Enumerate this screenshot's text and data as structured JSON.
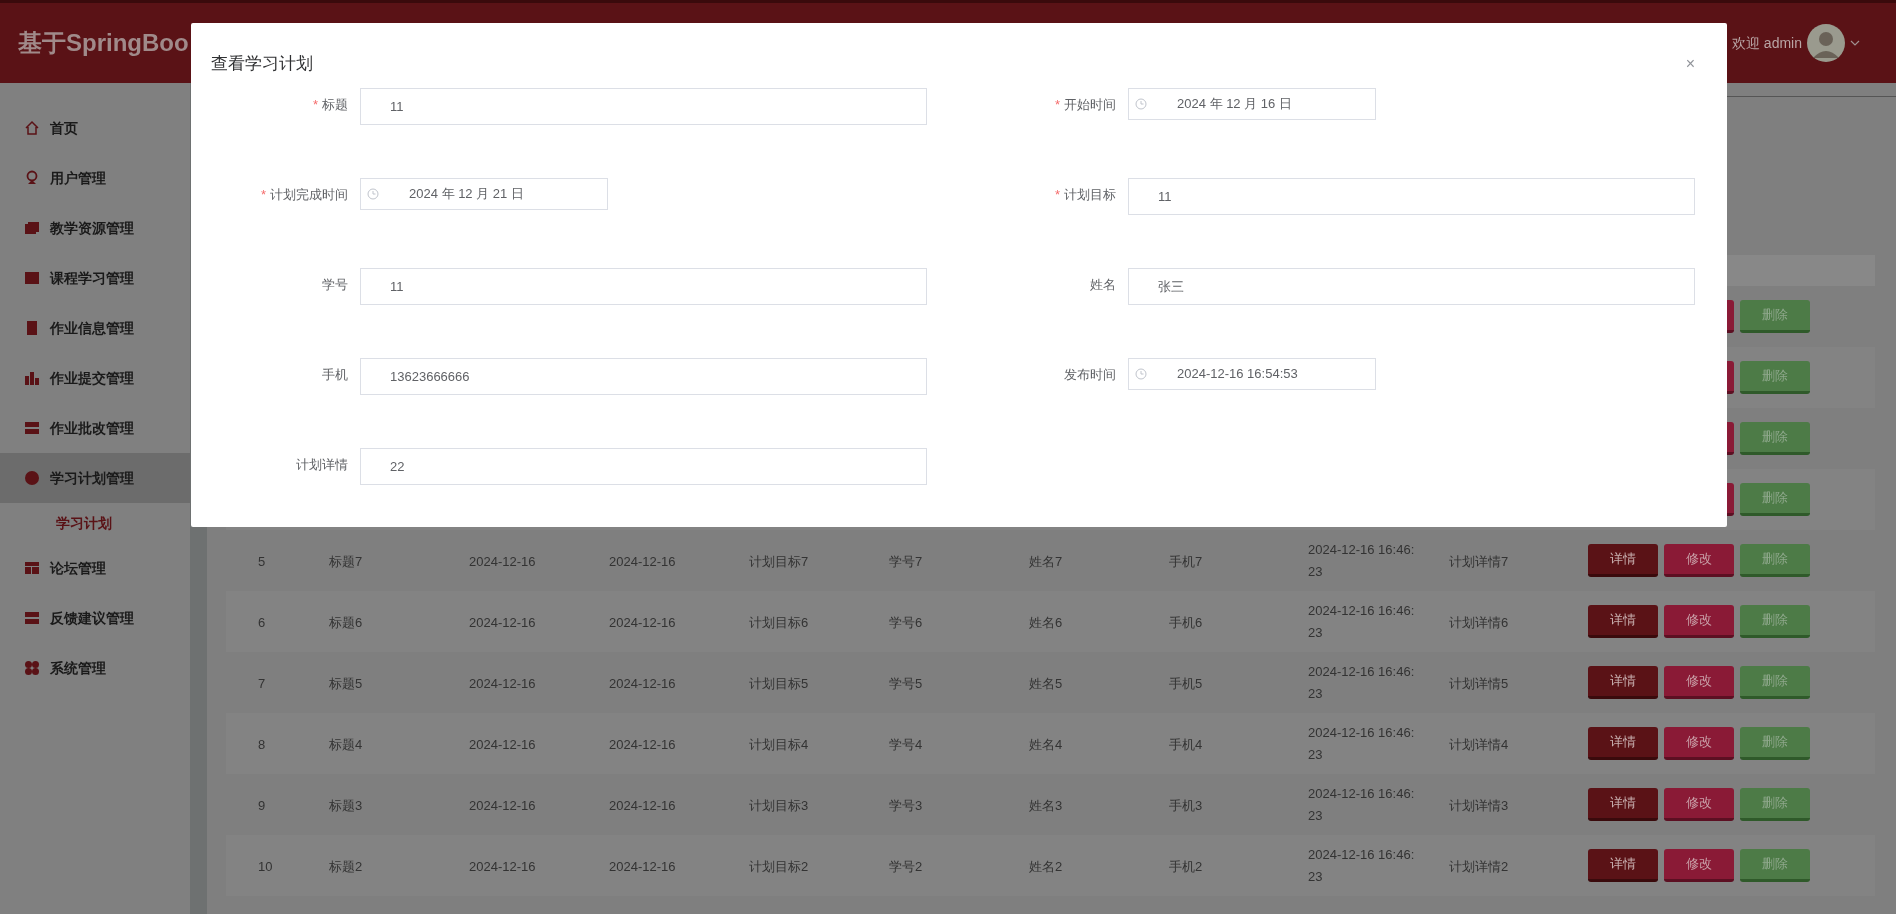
{
  "header": {
    "title": "基于SpringBoo",
    "greeting": "欢迎 admin"
  },
  "sidebar": {
    "items": [
      {
        "label": "首页",
        "selected": false
      },
      {
        "label": "用户管理",
        "selected": false
      },
      {
        "label": "教学资源管理",
        "selected": false
      },
      {
        "label": "课程学习管理",
        "selected": false
      },
      {
        "label": "作业信息管理",
        "selected": false
      },
      {
        "label": "作业提交管理",
        "selected": false
      },
      {
        "label": "作业批改管理",
        "selected": false
      },
      {
        "label": "学习计划管理",
        "selected": true,
        "children": [
          {
            "label": "学习计划",
            "selected": true
          }
        ]
      },
      {
        "label": "论坛管理",
        "selected": false
      },
      {
        "label": "反馈建议管理",
        "selected": false
      },
      {
        "label": "系统管理",
        "selected": false
      }
    ]
  },
  "table": {
    "rows": [
      {
        "actions": [
          {
            "label": "删除",
            "kind": "delete"
          }
        ]
      },
      {
        "actions": [
          {
            "label": "删除",
            "kind": "delete"
          }
        ]
      },
      {
        "actions": [
          {
            "label": "删除",
            "kind": "delete"
          }
        ]
      },
      {
        "actions": [
          {
            "label": "删除",
            "kind": "delete"
          }
        ]
      },
      {
        "cells": [
          "5",
          "标题7",
          "2024-12-16",
          "2024-12-16",
          "计划目标7",
          "学号7",
          "姓名7",
          "手机7",
          "2024-12-16 16:46:23",
          "计划详情7"
        ],
        "actions": [
          {
            "label": "详情",
            "kind": "view"
          },
          {
            "label": "修改",
            "kind": "edit"
          },
          {
            "label": "删除",
            "kind": "delete"
          }
        ]
      },
      {
        "cells": [
          "6",
          "标题6",
          "2024-12-16",
          "2024-12-16",
          "计划目标6",
          "学号6",
          "姓名6",
          "手机6",
          "2024-12-16 16:46:23",
          "计划详情6"
        ],
        "actions": [
          {
            "label": "详情",
            "kind": "view"
          },
          {
            "label": "修改",
            "kind": "edit"
          },
          {
            "label": "删除",
            "kind": "delete"
          }
        ]
      },
      {
        "cells": [
          "7",
          "标题5",
          "2024-12-16",
          "2024-12-16",
          "计划目标5",
          "学号5",
          "姓名5",
          "手机5",
          "2024-12-16 16:46:23",
          "计划详情5"
        ],
        "actions": [
          {
            "label": "详情",
            "kind": "view"
          },
          {
            "label": "修改",
            "kind": "edit"
          },
          {
            "label": "删除",
            "kind": "delete"
          }
        ]
      },
      {
        "cells": [
          "8",
          "标题4",
          "2024-12-16",
          "2024-12-16",
          "计划目标4",
          "学号4",
          "姓名4",
          "手机4",
          "2024-12-16 16:46:23",
          "计划详情4"
        ],
        "actions": [
          {
            "label": "详情",
            "kind": "view"
          },
          {
            "label": "修改",
            "kind": "edit"
          },
          {
            "label": "删除",
            "kind": "delete"
          }
        ]
      },
      {
        "cells": [
          "9",
          "标题3",
          "2024-12-16",
          "2024-12-16",
          "计划目标3",
          "学号3",
          "姓名3",
          "手机3",
          "2024-12-16 16:46:23",
          "计划详情3"
        ],
        "actions": [
          {
            "label": "详情",
            "kind": "view"
          },
          {
            "label": "修改",
            "kind": "edit"
          },
          {
            "label": "删除",
            "kind": "delete"
          }
        ]
      },
      {
        "cells": [
          "10",
          "标题2",
          "2024-12-16",
          "2024-12-16",
          "计划目标2",
          "学号2",
          "姓名2",
          "手机2",
          "2024-12-16 16:46:23",
          "计划详情2"
        ],
        "actions": [
          {
            "label": "详情",
            "kind": "view"
          },
          {
            "label": "修改",
            "kind": "edit"
          },
          {
            "label": "删除",
            "kind": "delete"
          }
        ]
      }
    ]
  },
  "dialog": {
    "title": "查看学习计划",
    "close": "×",
    "fields": [
      {
        "required_mark": "*",
        "label": "标题",
        "kind": "text",
        "value": "11"
      },
      {
        "required_mark": "*",
        "label": "开始时间",
        "kind": "date",
        "value": "2024 年 12 月 16 日"
      },
      {
        "required_mark": "*",
        "label": "计划完成时间",
        "kind": "date",
        "value": "2024 年 12 月 21 日"
      },
      {
        "required_mark": "*",
        "label": "计划目标",
        "kind": "text",
        "value": "11"
      },
      {
        "label": "学号",
        "kind": "text",
        "value": "11"
      },
      {
        "label": "姓名",
        "kind": "text",
        "value": "张三"
      },
      {
        "label": "手机",
        "kind": "text",
        "value": "13623666666"
      },
      {
        "label": "发布时间",
        "kind": "date",
        "value": "2024-12-16 16:54:53"
      },
      {
        "label": "计划详情",
        "kind": "text",
        "value": "22"
      }
    ]
  }
}
